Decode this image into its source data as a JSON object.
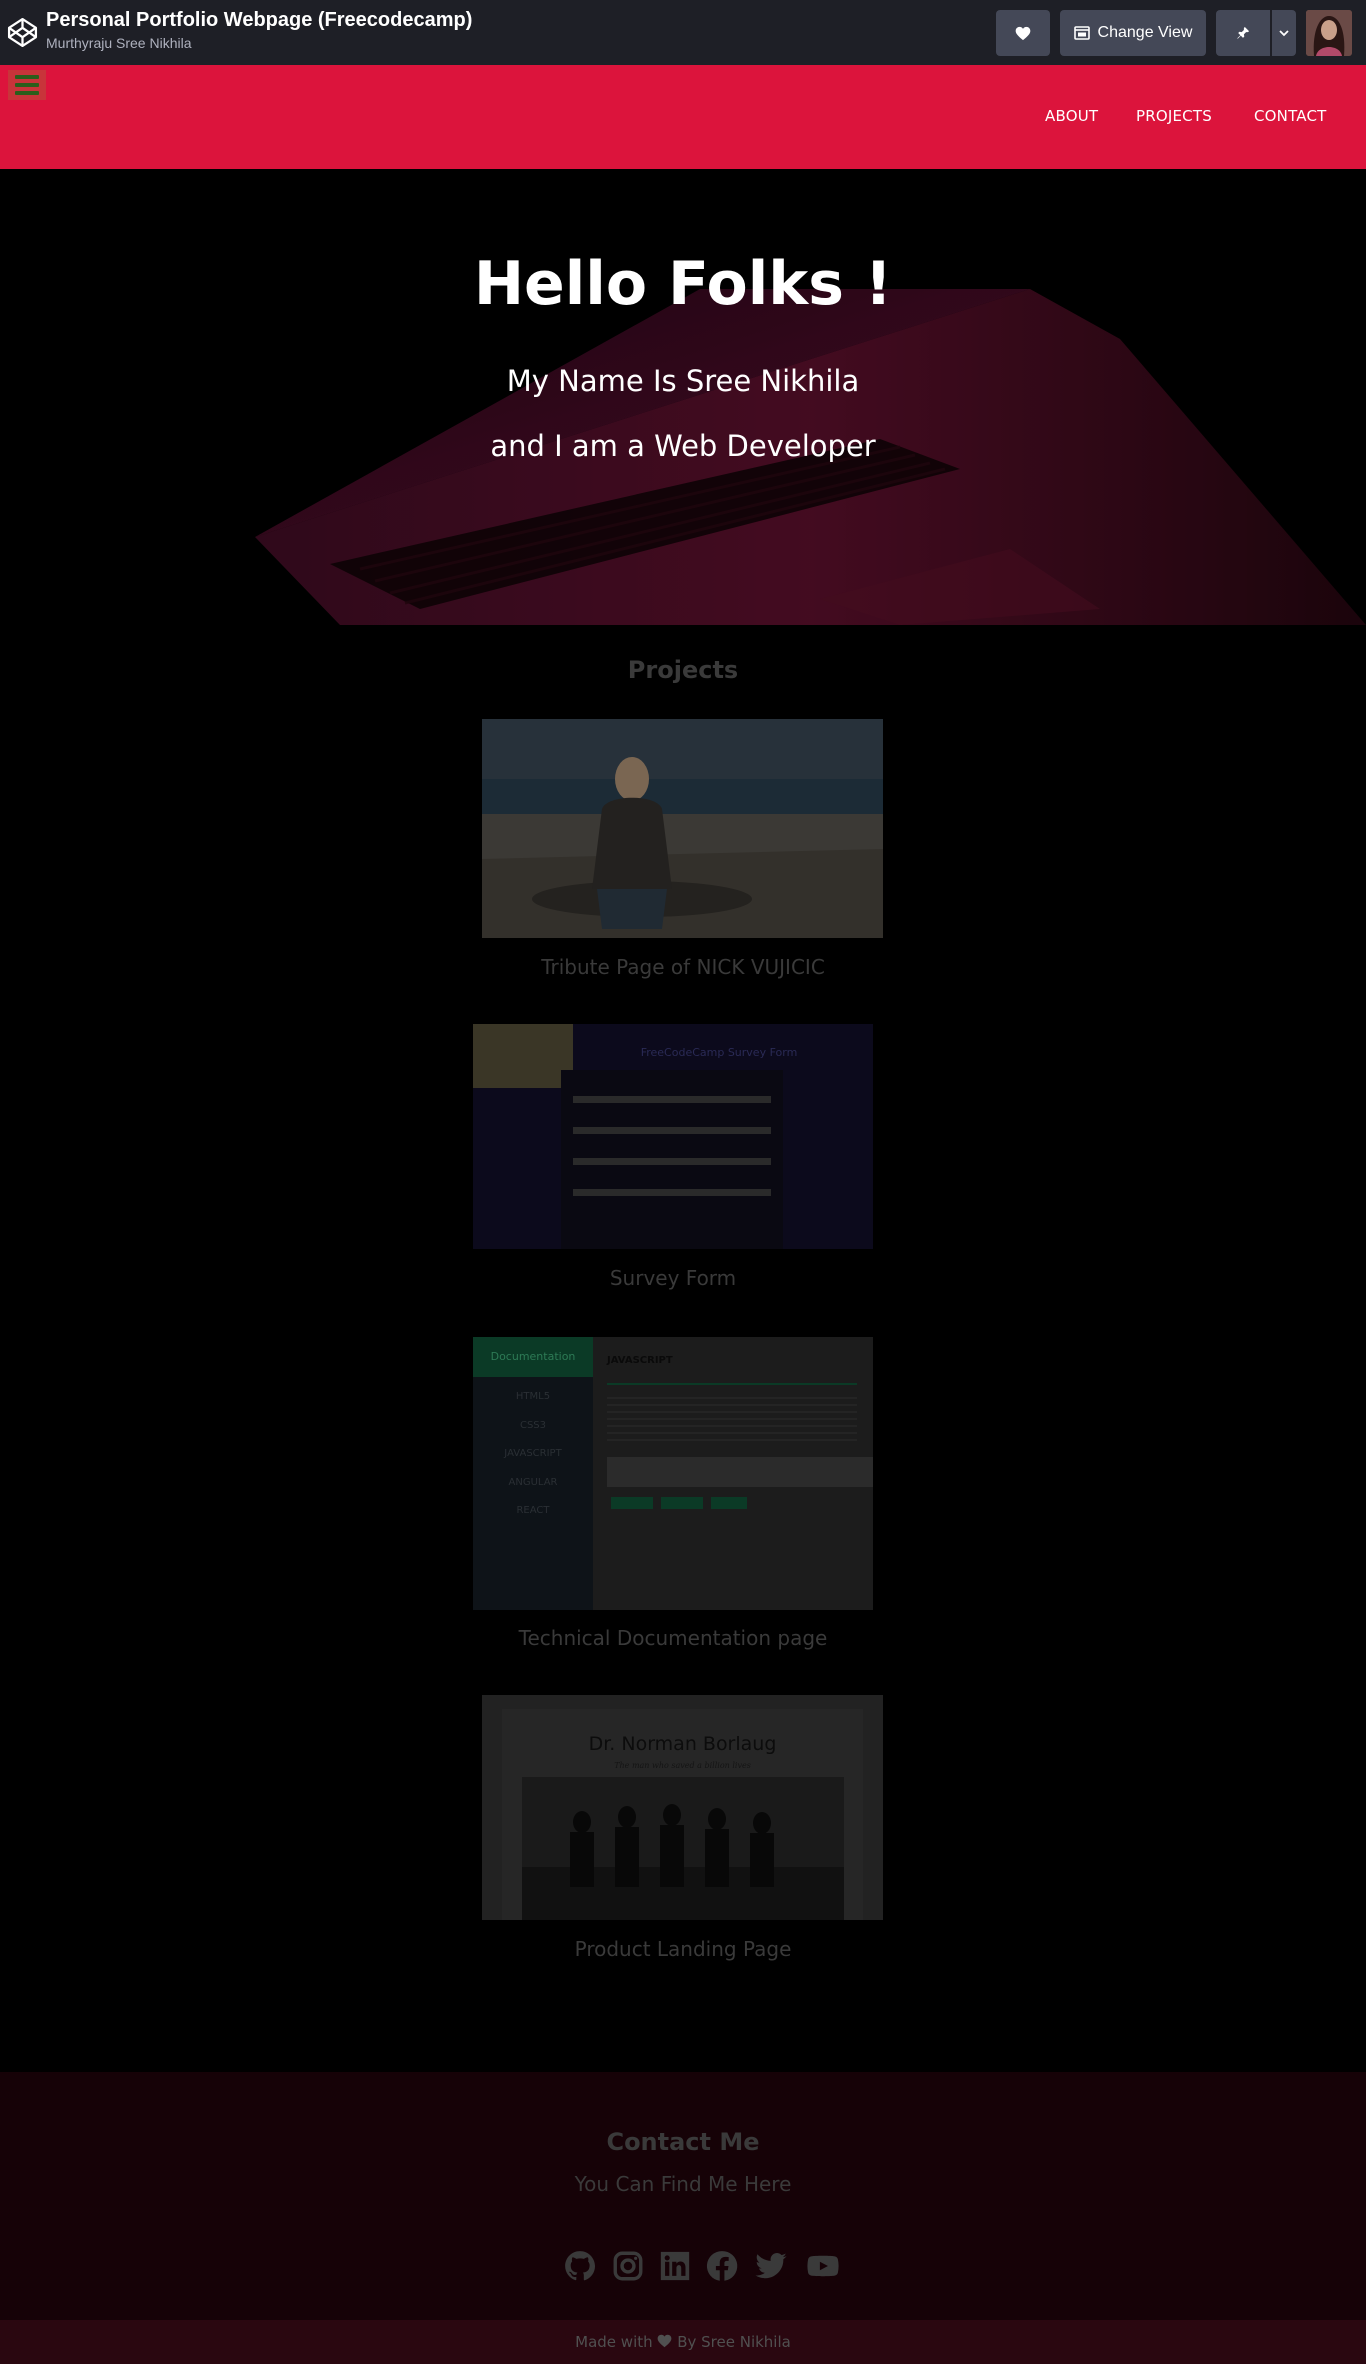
{
  "codepen": {
    "title": "Personal Portfolio Webpage (Freecodecamp)",
    "author": "Murthyraju Sree Nikhila",
    "change_view_label": "Change View",
    "icons": [
      "codepen-logo-icon",
      "heart-icon",
      "layout-icon",
      "pin-icon",
      "chevron-down-icon"
    ]
  },
  "nav": {
    "links": [
      "ABOUT",
      "PROJECTS",
      "CONTACT"
    ]
  },
  "hero": {
    "title": "Hello Folks !",
    "line1": "My Name Is Sree Nikhila",
    "line2": "and I am a Web Developer"
  },
  "projects": {
    "title": "Projects",
    "items": [
      {
        "caption": "Tribute Page of NICK VUJICIC"
      },
      {
        "caption": "Survey Form",
        "thumb_title": "FreeCodeCamp Survey Form"
      },
      {
        "caption": "Technical Documentation page",
        "thumb_brand": "Documentation",
        "thumb_heading": "JAVASCRIPT",
        "thumb_menu": [
          "HTML5",
          "CSS3",
          "JAVASCRIPT",
          "ANGULAR",
          "REACT"
        ]
      },
      {
        "caption": "Product Landing Page",
        "thumb_title": "Dr. Norman Borlaug",
        "thumb_subtitle": "The man who saved a billion lives"
      }
    ]
  },
  "contact": {
    "title": "Contact Me",
    "subtitle": "You Can Find Me Here",
    "socials": [
      "github-icon",
      "instagram-icon",
      "linkedin-icon",
      "facebook-icon",
      "twitter-icon",
      "youtube-icon"
    ]
  },
  "footer": {
    "made_with": "Made with",
    "by": "By Sree Nikhila"
  },
  "colors": {
    "nav_bg": "#dc143c",
    "codepen_bar": "#1e1f26",
    "contact_bg": "#160207",
    "footer_bg": "#2a0710"
  }
}
